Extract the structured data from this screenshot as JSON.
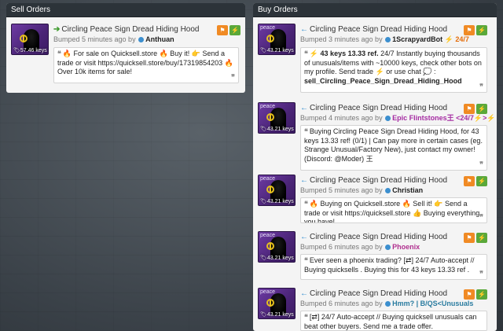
{
  "sell": {
    "header": "Sell Orders",
    "listings": [
      {
        "peace_label": "",
        "price": "57.46 keys",
        "title": "Circling Peace Sign Dread Hiding Hood",
        "bumped": "Bumped 5 minutes ago by",
        "user": "Anthuan",
        "message": "🔥 For sale on Quicksell.store 🔥 Buy it! 👉 Send a trade or visit https://quicksell.store/buy/17319854203 🔥 Over 10k items for sale!"
      }
    ]
  },
  "buy": {
    "header": "Buy Orders",
    "listings": [
      {
        "peace_label": "peace",
        "price": "43.21 keys",
        "title": "Circling Peace Sign Dread Hiding Hood",
        "bumped": "Bumped 3 minutes ago by",
        "user": "1ScrapyardBot",
        "user_suffix": "⚡ 24/7",
        "message_lead": "⚡ 43 keys 13.33 ref.",
        "message": " 24/7 Instantly buying thousands of unusuals/items with ~10000 keys, check other bots on my profile. Send trade ⚡ or use chat 💭 :",
        "message_tail": "sell_Circling_Peace_Sign_Dread_Hiding_Hood"
      },
      {
        "peace_label": "peace",
        "price": "43.21 keys",
        "title": "Circling Peace Sign Dread Hiding Hood",
        "bumped": "Bumped 4 minutes ago by",
        "user": "Epic Flintstones王 <24/7⚡>⚡",
        "message": "Buying Circling Peace Sign Dread Hiding Hood, for 43 keys 13.33 ref! (0/1) | Can pay more in certain cases (eg. Strange Unusual/Factory New), just contact my owner! (Discord: @Moder) 王"
      },
      {
        "peace_label": "peace",
        "price": "43.21 keys",
        "title": "Circling Peace Sign Dread Hiding Hood",
        "bumped": "Bumped 5 minutes ago by",
        "user": "Christian",
        "message": "🔥 Buying on Quicksell.store 🔥 Sell it! 👉 Send a trade or visit https://quicksell.store 👍 Buying everything you have!"
      },
      {
        "peace_label": "peace",
        "price": "43.21 keys",
        "title": "Circling Peace Sign Dread Hiding Hood",
        "bumped": "Bumped 6 minutes ago by",
        "user": "Phoenix",
        "message": "Ever seen a phoenix trading? [⇄] 24/7 Auto-accept // Buying quicksells . Buying this for 43 keys 13.33 ref ."
      },
      {
        "peace_label": "peace",
        "price": "43.21 keys",
        "title": "Circling Peace Sign Dread Hiding Hood",
        "bumped": "Bumped 6 minutes ago by",
        "user": "Hmm? | B/QS<Unusuals",
        "message": "[⇄] 24/7 Auto-accept // Buying quicksell unusuals can beat other buyers. Send me a trade offer."
      }
    ]
  },
  "icons": {
    "flag": "⚑",
    "bolt": "⚡",
    "tag": "🏷",
    "quote_open": "❝",
    "quote_close": "❞",
    "sell_arrow": "➔",
    "buy_arrow": "🡐"
  },
  "colors": {
    "header_bg": "#2c3339",
    "flag_btn": "#f08a24",
    "bolt_btn": "#5aa83a",
    "sell_arrow": "#3d9a2c",
    "buy_arrow": "#2e8bcf"
  }
}
